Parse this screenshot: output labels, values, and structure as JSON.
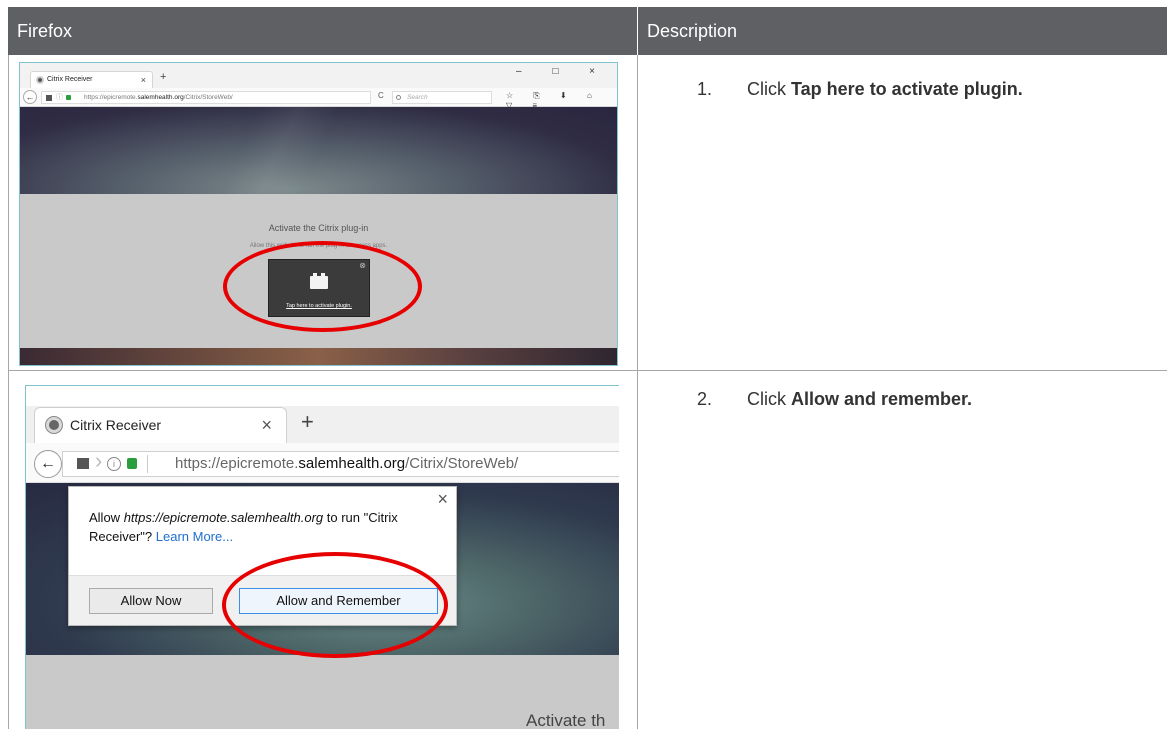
{
  "table": {
    "col_left": "Firefox",
    "col_right": "Description"
  },
  "steps": [
    {
      "num": "1.",
      "text": "Click ",
      "bold": "Tap here to activate plugin."
    },
    {
      "num": "2.",
      "text": "Click ",
      "bold": "Allow and remember."
    }
  ],
  "shot1": {
    "tab_title": "Citrix Receiver",
    "tab_close": "×",
    "new_tab": "+",
    "window_buttons": "– □ ×",
    "url_prefix": "https://epicremote.",
    "url_domain": "salemhealth.org",
    "url_path": "/Citrix/StoreWeb/",
    "search_placeholder": "Search",
    "reload": "C",
    "toolbar_icons": "☆ ⎘ ⬇ ⌂ ▽ ≡",
    "page_title": "Activate the Citrix plug-in",
    "page_subtitle": "Allow this website to run the plug-in to access apps.",
    "plugin_link": "Tap here to activate plugin.",
    "plugin_close": "⊗"
  },
  "shot2": {
    "tab_title": "Citrix Receiver",
    "tab_close": "×",
    "new_tab": "+",
    "url_prefix": "https://epicremote.",
    "url_domain": "salemhealth.org",
    "url_path": "/Citrix/StoreWeb/",
    "popup_allow": "Allow ",
    "popup_site": "https://epicremote.salemhealth.org",
    "popup_rest": " to run \"Citrix Receiver\"? ",
    "popup_learn": "Learn More...",
    "popup_close": "×",
    "btn_allow_now": "Allow Now",
    "btn_allow_remember": "Allow and Remember",
    "bottom_text": "Activate th"
  },
  "colors": {
    "header_bg": "#5f6063",
    "annotation_red": "#e60000"
  }
}
